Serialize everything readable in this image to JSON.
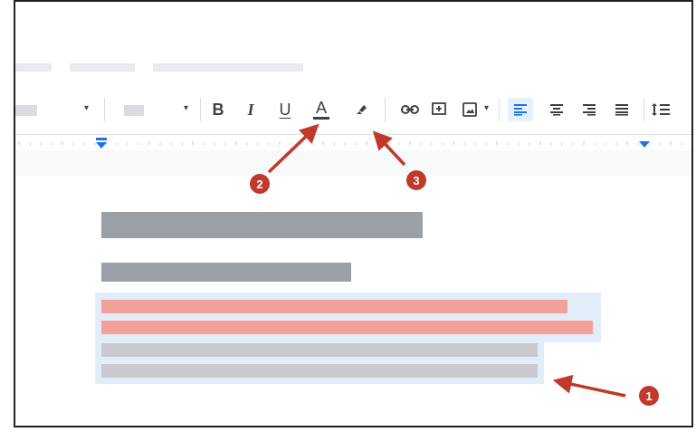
{
  "toolbar": {
    "bold_label": "B",
    "italic_label": "I",
    "underline_label": "U",
    "text_color_label": "A",
    "text_color_underline": "#3c4043",
    "dropdown_caret": "▾",
    "highlight_icon": "highlighter-icon",
    "link_icon": "link-icon",
    "comment_icon": "add-comment-icon",
    "image_icon": "insert-image-icon",
    "align_left_icon": "align-left-icon",
    "align_center_icon": "align-center-icon",
    "align_right_icon": "align-right-icon",
    "justify_icon": "justify-icon",
    "line_spacing_icon": "line-spacing-icon",
    "active_color": "#1a73e8"
  },
  "callouts": {
    "one": "1",
    "two": "2",
    "three": "3",
    "color": "#c0392b"
  },
  "document": {
    "heading_color": "#9aa0a6",
    "highlight_color": "#f4a09a",
    "body_color": "#c8cacd",
    "selection_color": "#e3ecf9"
  }
}
